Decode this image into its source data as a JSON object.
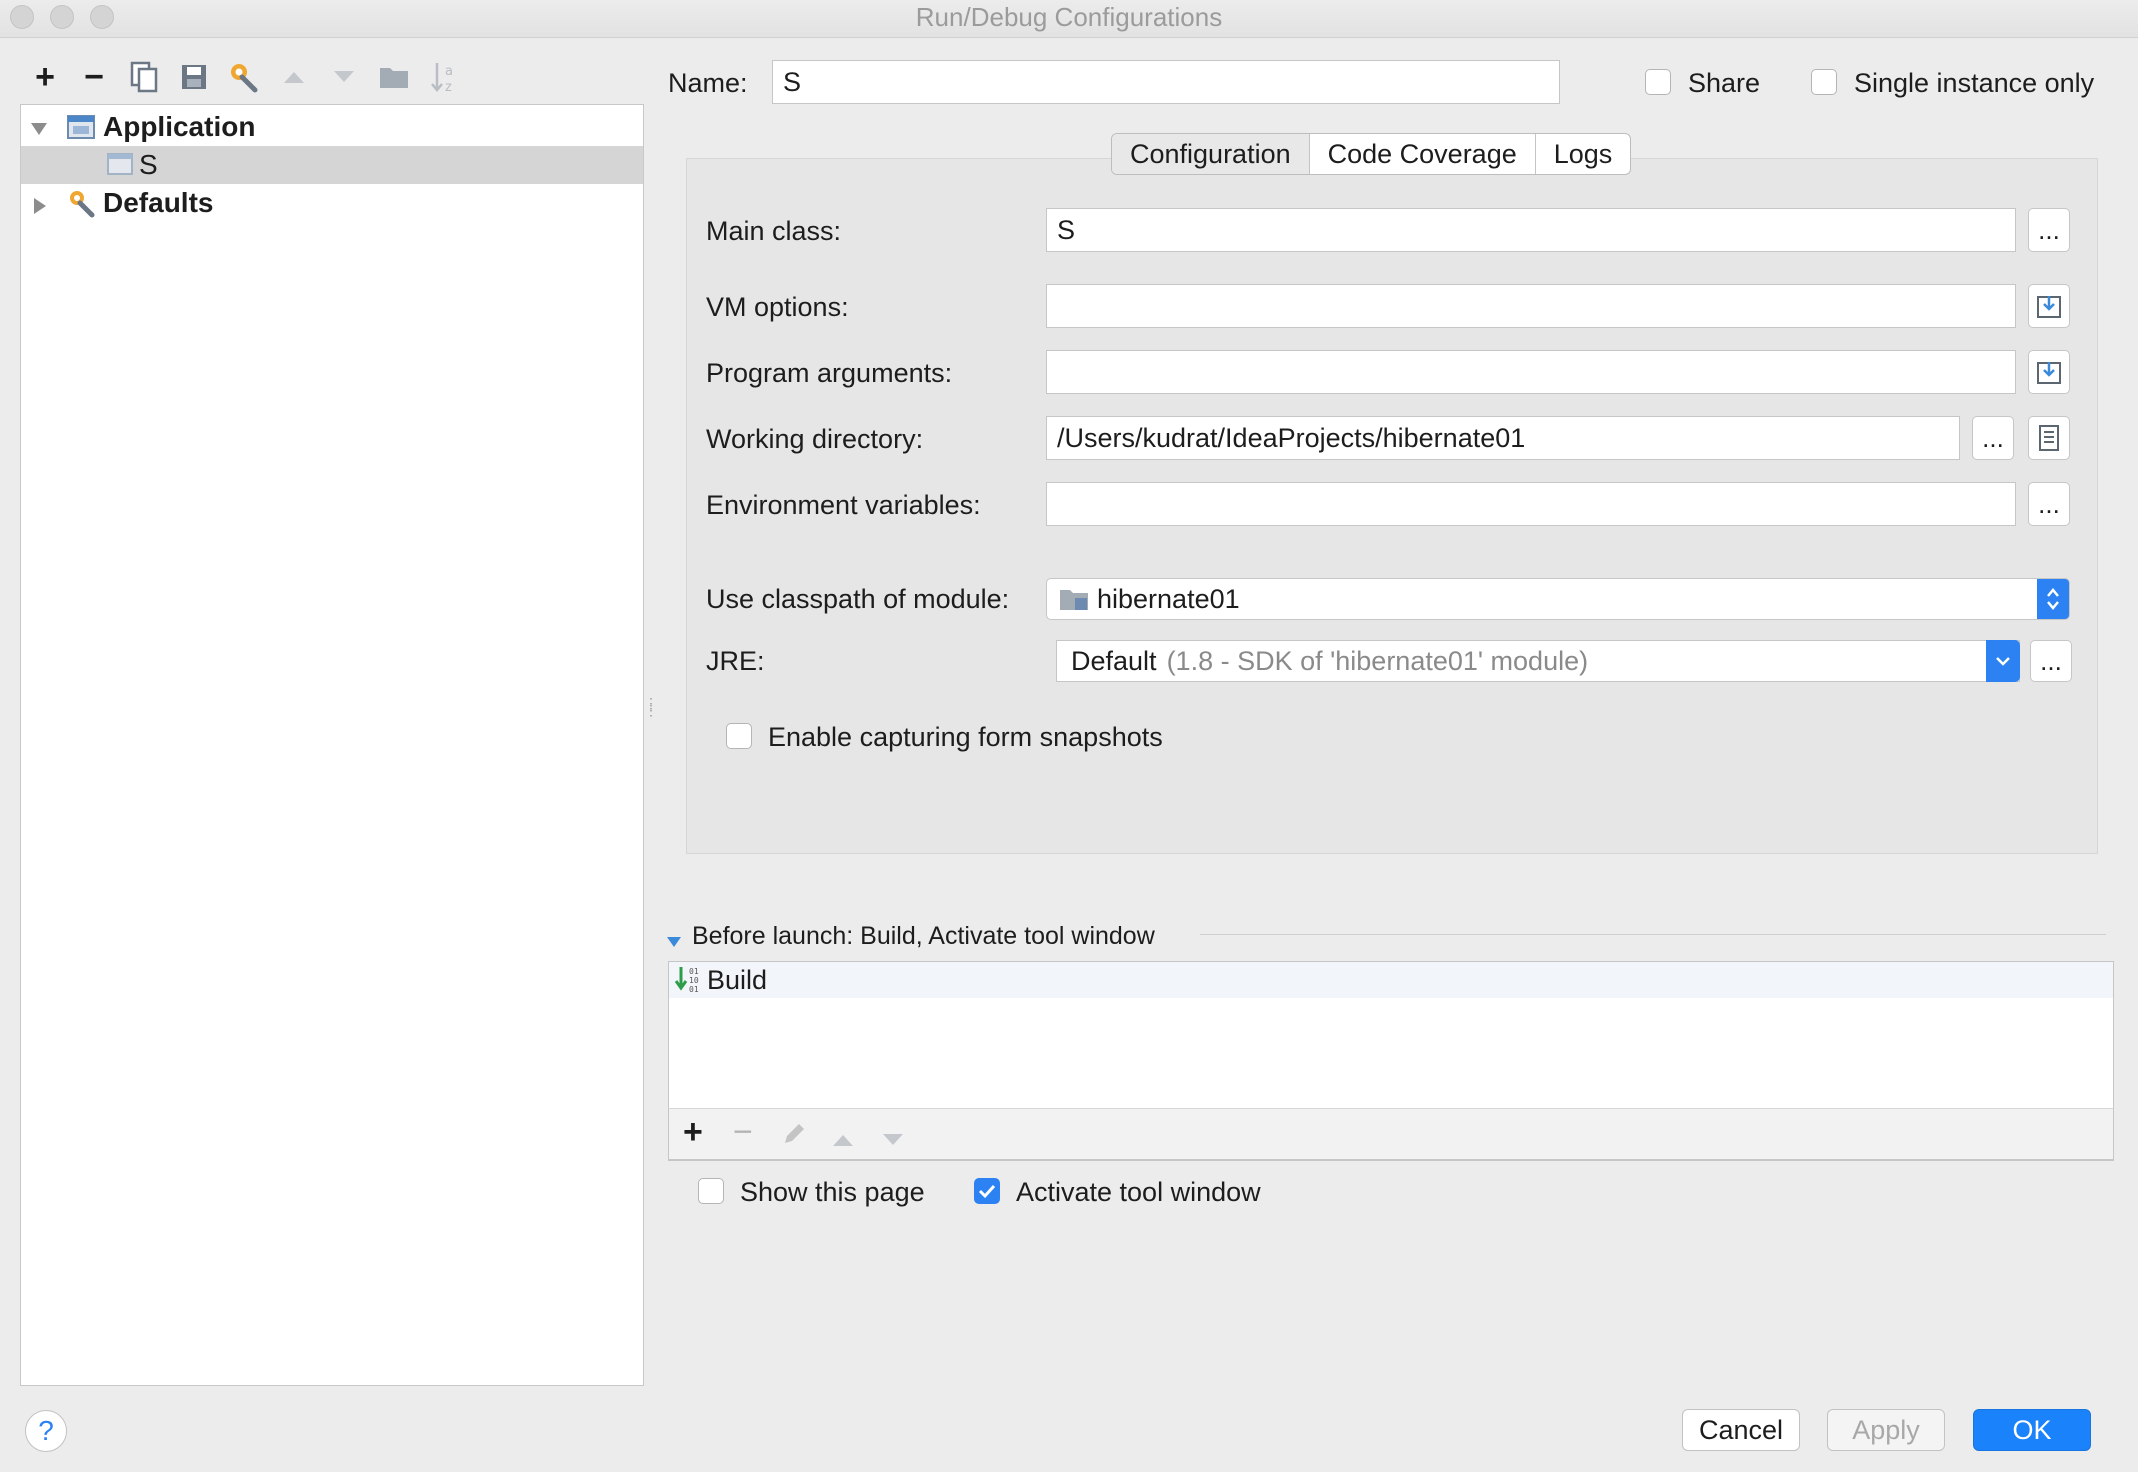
{
  "window": {
    "title": "Run/Debug Configurations"
  },
  "toolbar": {
    "icons": [
      "add-icon",
      "remove-icon",
      "copy-icon",
      "save-icon",
      "wrench-icon",
      "move-up-icon",
      "move-down-icon",
      "folder-icon",
      "sort-icon"
    ],
    "add": "+",
    "remove": "−"
  },
  "tree": {
    "application": "Application",
    "child": "S",
    "defaults": "Defaults"
  },
  "name_row": {
    "label": "Name:",
    "value": "S",
    "share": {
      "label": "Share",
      "checked": false
    },
    "single_instance": {
      "label": "Single instance only",
      "checked": false
    }
  },
  "tabs": [
    "Configuration",
    "Code Coverage",
    "Logs"
  ],
  "active_tab": "Configuration",
  "config": {
    "main_class": {
      "label": "Main class:",
      "value": "S"
    },
    "vm_options": {
      "label": "VM options:",
      "value": ""
    },
    "program_args": {
      "label": "Program arguments:",
      "value": ""
    },
    "working_dir": {
      "label": "Working directory:",
      "value": "/Users/kudrat/IdeaProjects/hibernate01"
    },
    "env_vars": {
      "label": "Environment variables:",
      "value": ""
    },
    "classpath": {
      "label": "Use classpath of module:",
      "value": "hibernate01"
    },
    "jre": {
      "label": "JRE:",
      "value": "Default",
      "detail": "(1.8 - SDK of 'hibernate01' module)"
    },
    "snapshots": {
      "label": "Enable capturing form snapshots",
      "checked": false
    },
    "ellipsis": "..."
  },
  "before_launch": {
    "header": "Before launch: Build, Activate tool window",
    "items": [
      "Build"
    ],
    "show_page": {
      "label": "Show this page",
      "checked": false
    },
    "activate_tool": {
      "label": "Activate tool window",
      "checked": true
    }
  },
  "footer": {
    "help": "?",
    "cancel": "Cancel",
    "apply": "Apply",
    "ok": "OK"
  },
  "colors": {
    "accent": "#2c82f2",
    "ok_button": "#1a82fb",
    "selection": "#d5d5d5"
  }
}
